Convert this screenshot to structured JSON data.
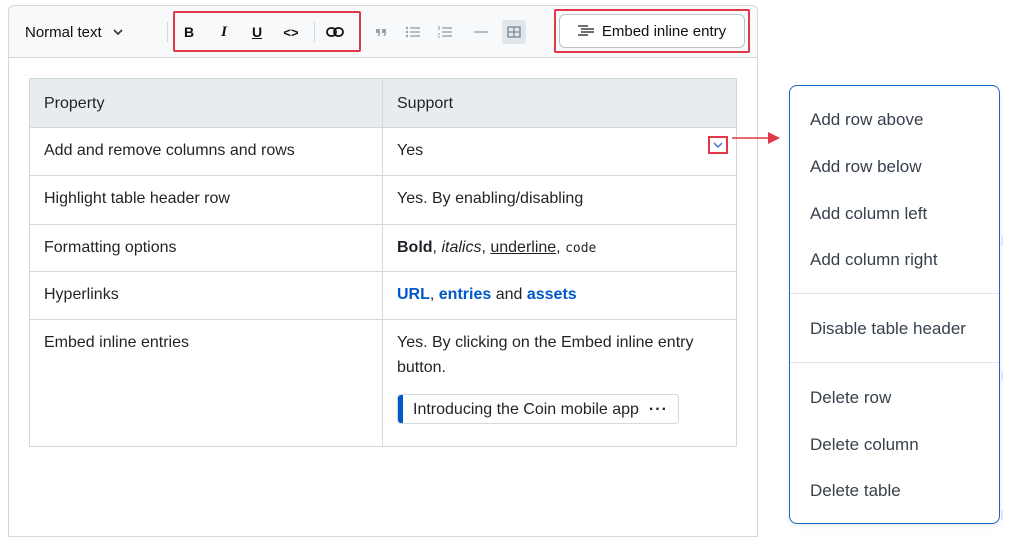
{
  "toolbar": {
    "style_select": "Normal text",
    "bold": "B",
    "italic": "I",
    "underline": "U",
    "code": "<>",
    "embed_inline_entry": "Embed inline entry"
  },
  "table": {
    "headers": [
      "Property",
      "Support"
    ],
    "rows": [
      [
        "Add and remove columns and rows",
        "Yes"
      ],
      [
        "Highlight table header row",
        "Yes. By enabling/disabling"
      ],
      [
        "Formatting options",
        ""
      ],
      [
        "Hyperlinks",
        ""
      ],
      [
        "Embed inline entries",
        "Yes. By clicking on the Embed inline entry button."
      ]
    ],
    "formatting": {
      "bold": "Bold",
      "sep1": ", ",
      "italic": "italics",
      "sep2": ", ",
      "underline": "underline",
      "sep3": ", ",
      "code": "code"
    },
    "hyperlinks": {
      "url": "URL",
      "sep1": ", ",
      "entries": "entries",
      "and": " and ",
      "assets": "assets"
    },
    "embedded_entry": {
      "title": "Introducing the Coin mobile app",
      "more": "···"
    }
  },
  "context_menu": {
    "items": [
      "Add row above",
      "Add row below",
      "Add column left",
      "Add column right",
      "Disable table header",
      "Delete row",
      "Delete column",
      "Delete table"
    ]
  },
  "colors": {
    "highlight_red": "#e2384a",
    "link_blue": "#0059c8",
    "menu_border": "#1a66c2"
  }
}
